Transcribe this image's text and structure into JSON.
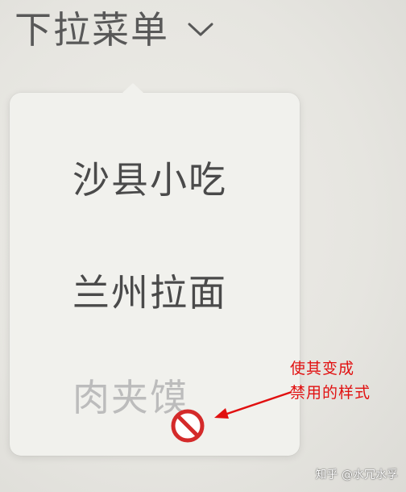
{
  "dropdown": {
    "trigger_label": "下拉菜单",
    "chevron_icon": "chevron-down-icon",
    "items": [
      {
        "label": "沙县小吃",
        "disabled": false
      },
      {
        "label": "兰州拉面",
        "disabled": false
      },
      {
        "label": "肉夹馍",
        "disabled": true
      }
    ]
  },
  "cursor": {
    "icon": "not-allowed-icon",
    "color": "#d42a2a"
  },
  "annotation": {
    "line1": "使其变成",
    "line2": "禁用的样式",
    "color": "#e11010"
  },
  "watermark": "知乎 @水冗水孚"
}
